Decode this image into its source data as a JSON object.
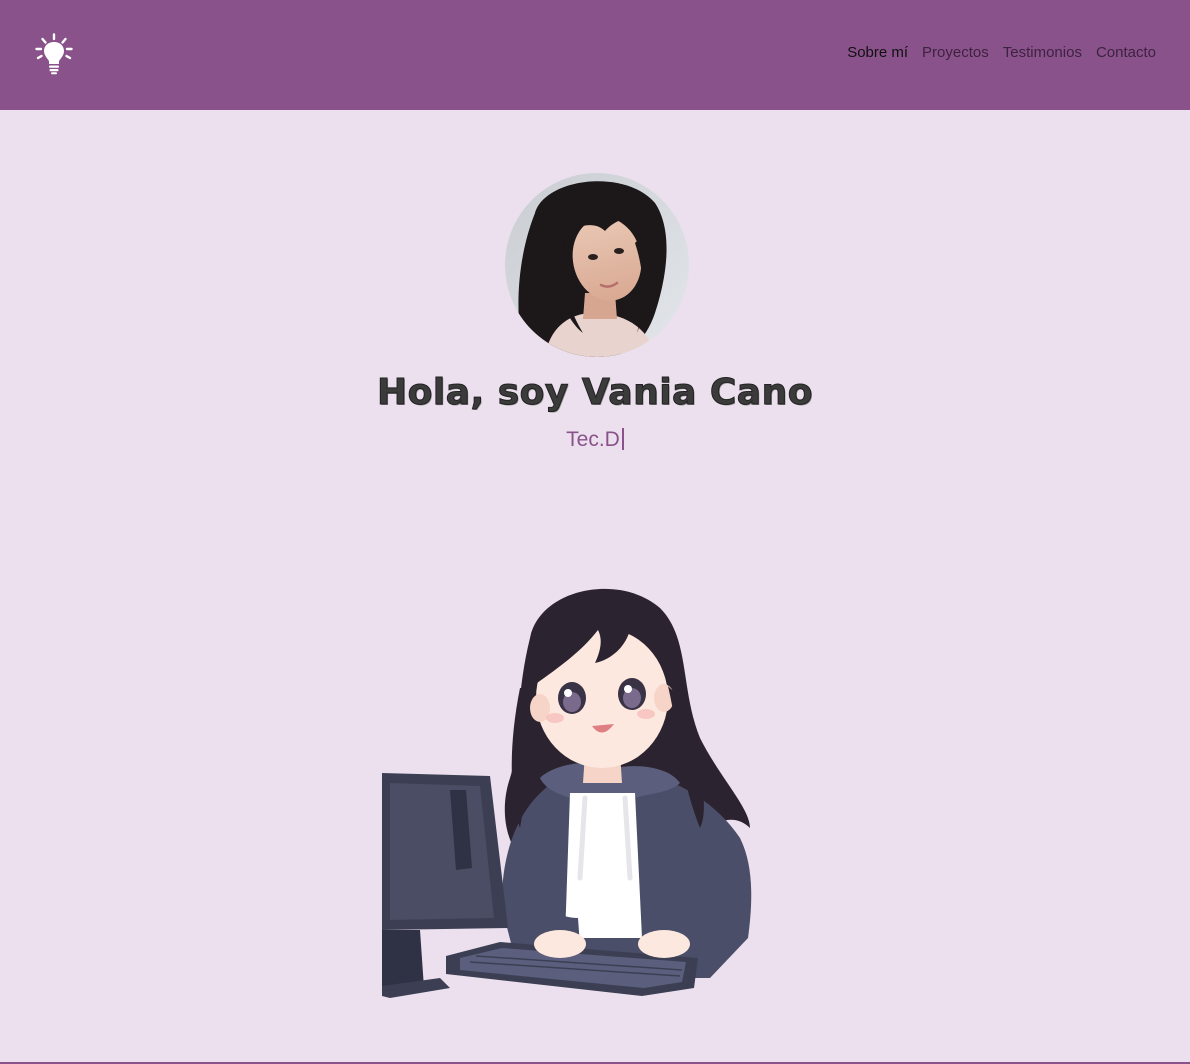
{
  "navbar": {
    "logo_icon": "lightbulb-icon",
    "links": [
      {
        "label": "Sobre mí",
        "active": true
      },
      {
        "label": "Proyectos",
        "active": false
      },
      {
        "label": "Testimonios",
        "active": false
      },
      {
        "label": "Contacto",
        "active": false
      }
    ]
  },
  "hero": {
    "title": "Hola, soy Vania Cano",
    "subtitle": "Tec.D",
    "avatar_icon": "profile-photo",
    "illustration_icon": "girl-at-computer-illustration"
  },
  "colors": {
    "brand": "#8a528b",
    "background": "#ece0ee",
    "title": "#3b3b3b"
  }
}
